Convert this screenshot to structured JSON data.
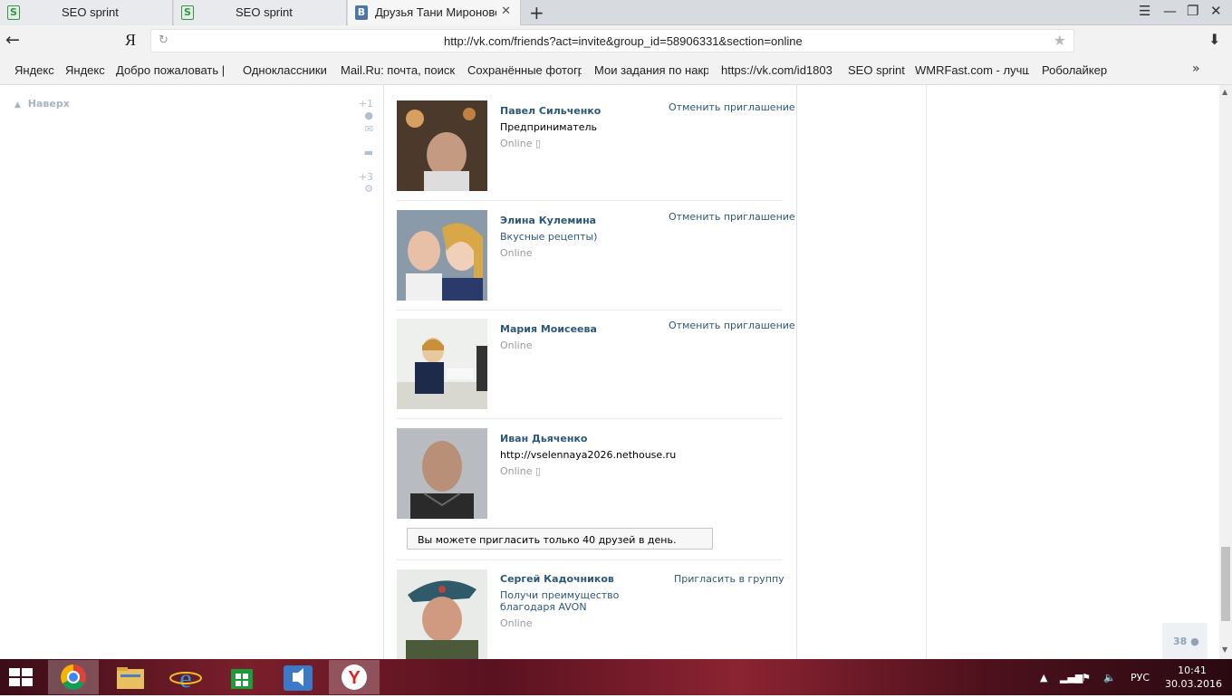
{
  "browser": {
    "tabs": [
      {
        "title": "SEO sprint"
      },
      {
        "title": "SEO sprint"
      },
      {
        "title": "Друзья Тани Мироновой",
        "close": "✕"
      }
    ],
    "new_tab": "+",
    "yandex_logo": "Я",
    "url": "http://vk.com/friends?act=invite&group_id=58906331&section=online",
    "bookmarks": [
      "Яндекс",
      "Яндекс",
      "Добро пожаловать |",
      "Одноклассники",
      "Mail.Ru: почта, поиск",
      "Сохранённые фотогр",
      "Мои задания по накр",
      "https://vk.com/id1803",
      "SEO sprint",
      "WMRFast.com - лучш",
      "Роболайкер"
    ],
    "bookmarks_more": "»"
  },
  "sidebar": {
    "up_label": "Наверх",
    "friends_count": "+1",
    "settings_count": "+3"
  },
  "friends": [
    {
      "name": "Павел Сильченко",
      "status": "Предприниматель",
      "online": "Online",
      "action": "Отменить приглашение"
    },
    {
      "name": "Элина Кулемина",
      "status": "Вкусные рецепты)",
      "online": "Online",
      "action": "Отменить приглашение"
    },
    {
      "name": "Мария Моисеева",
      "status": "",
      "online": "Online",
      "action": "Отменить приглашение"
    },
    {
      "name": "Иван Дьяченко",
      "status": "http://vselennaya2026.nethouse.ru",
      "online": "Online",
      "action": ""
    },
    {
      "name": "Сергей Кадочников",
      "status": "Получи преимущество благодаря AVON",
      "online": "Online",
      "action": "Пригласить в группу"
    }
  ],
  "notice": "Вы можете пригласить только 40 друзей в день.",
  "online_counter": "38",
  "taskbar": {
    "language": "РУС",
    "time": "10:41",
    "date": "30.03.2016"
  }
}
